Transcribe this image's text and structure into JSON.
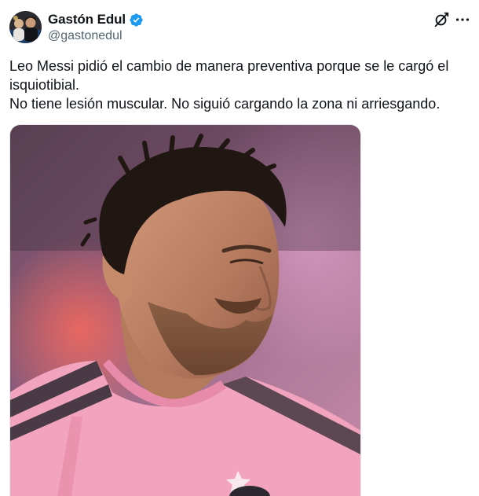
{
  "author": {
    "display_name": "Gastón Edul",
    "handle": "@gastonedul",
    "verified": true,
    "verified_color": "#1d9bf0"
  },
  "header_icons": {
    "grok": "grok-icon",
    "more": "more-options-icon"
  },
  "tweet": {
    "text": "Leo Messi pidió el cambio de manera preventiva porque se le cargó el isquiotibial.\nNo tiene lesión muscular. No siguió cargando la zona ni arriesgando."
  },
  "media": {
    "alt": "Photo of Lionel Messi in a pink Inter Miami jersey",
    "jersey_color": "#f2a3bd"
  }
}
